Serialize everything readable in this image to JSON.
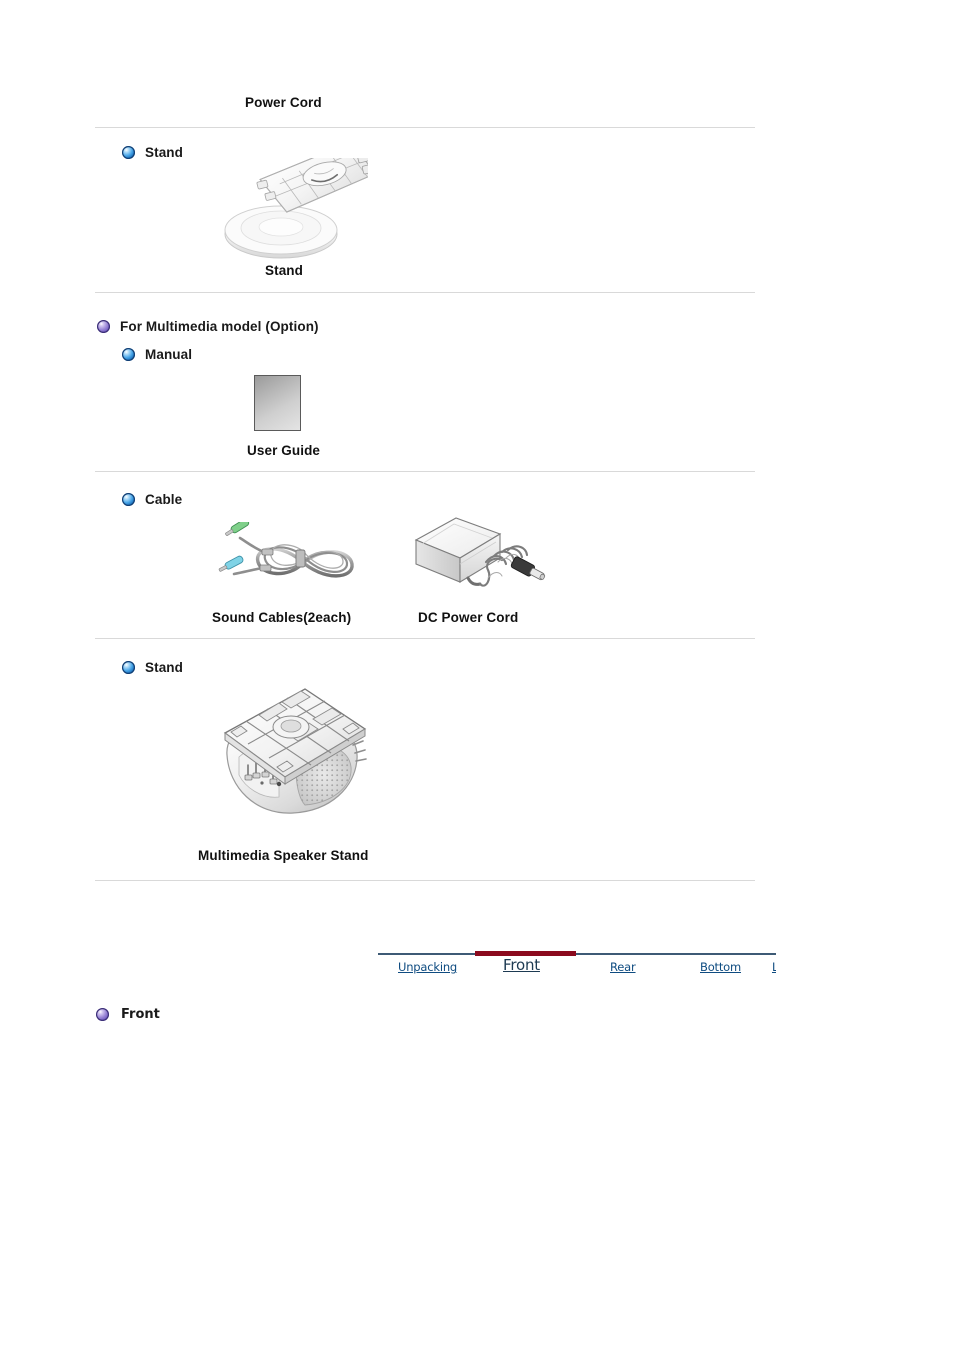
{
  "page": {
    "top_caption": "Power Cord"
  },
  "sections": [
    {
      "id": "stand-basic",
      "heading": "Stand",
      "bullet_color": "#2f86d8",
      "bullet_kind": "blue",
      "items": [
        {
          "caption": "Stand",
          "icon": "monitor-stand-illustration"
        }
      ]
    },
    {
      "id": "multimedia",
      "heading": "For Multimedia model (Option)",
      "bullet_color": "#6a53bd",
      "bullet_kind": "purple",
      "subsections": [
        {
          "id": "manual",
          "heading": "Manual",
          "bullet_kind": "blue",
          "items": [
            {
              "caption": "User Guide",
              "icon": "user-guide-booklet-illustration"
            }
          ]
        },
        {
          "id": "cable",
          "heading": "Cable",
          "bullet_kind": "blue",
          "items": [
            {
              "caption": "Sound Cables(2each)",
              "icon": "sound-cables-illustration"
            },
            {
              "caption": "DC Power Cord",
              "icon": "dc-power-adapter-illustration"
            }
          ]
        },
        {
          "id": "stand-multimedia",
          "heading": "Stand",
          "bullet_kind": "blue",
          "items": [
            {
              "caption": "Multimedia Speaker Stand",
              "icon": "multimedia-speaker-stand-illustration"
            }
          ]
        }
      ]
    }
  ],
  "tabs": {
    "items": [
      {
        "label": "Unpacking",
        "active": false
      },
      {
        "label": "Front",
        "active": true
      },
      {
        "label": "Rear",
        "active": false
      },
      {
        "label": "Bottom",
        "active": false
      },
      {
        "label": "L",
        "active": false,
        "clipped": true
      }
    ],
    "active_color": "#8b0a1e",
    "link_color": "#0f4c81",
    "rule_color": "#3d5a75"
  },
  "front_section": {
    "heading": "Front",
    "bullet_kind": "purple"
  }
}
